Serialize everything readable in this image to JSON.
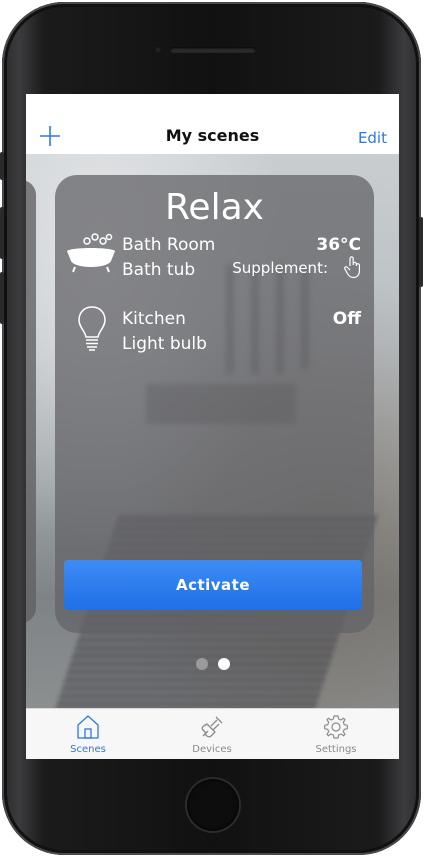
{
  "navbar": {
    "add_icon": "plus-icon",
    "title": "My scenes",
    "edit_label": "Edit"
  },
  "scene": {
    "title": "Relax",
    "devices": [
      {
        "icon": "bathtub-icon",
        "room": "Bath Room",
        "name": "Bath tub",
        "value": "36°C",
        "supplement_label": "Supplement:",
        "supplement_icon": "pointer-hand-icon"
      },
      {
        "icon": "light-bulb-icon",
        "room": "Kitchen",
        "name": "Light bulb",
        "value": "Off"
      }
    ],
    "activate_label": "Activate"
  },
  "pager": {
    "pages": 2,
    "active_index": 1
  },
  "tabbar": {
    "tabs": [
      {
        "label": "Scenes",
        "icon": "home-icon",
        "active": true
      },
      {
        "label": "Devices",
        "icon": "plug-icon",
        "active": false
      },
      {
        "label": "Settings",
        "icon": "gear-icon",
        "active": false
      }
    ]
  },
  "colors": {
    "accent": "#2f76e6",
    "activate_button": "#2679ee",
    "tab_inactive": "#8a8a8a",
    "dot_inactive": "#9a9a9a",
    "dot_active": "#ffffff"
  }
}
